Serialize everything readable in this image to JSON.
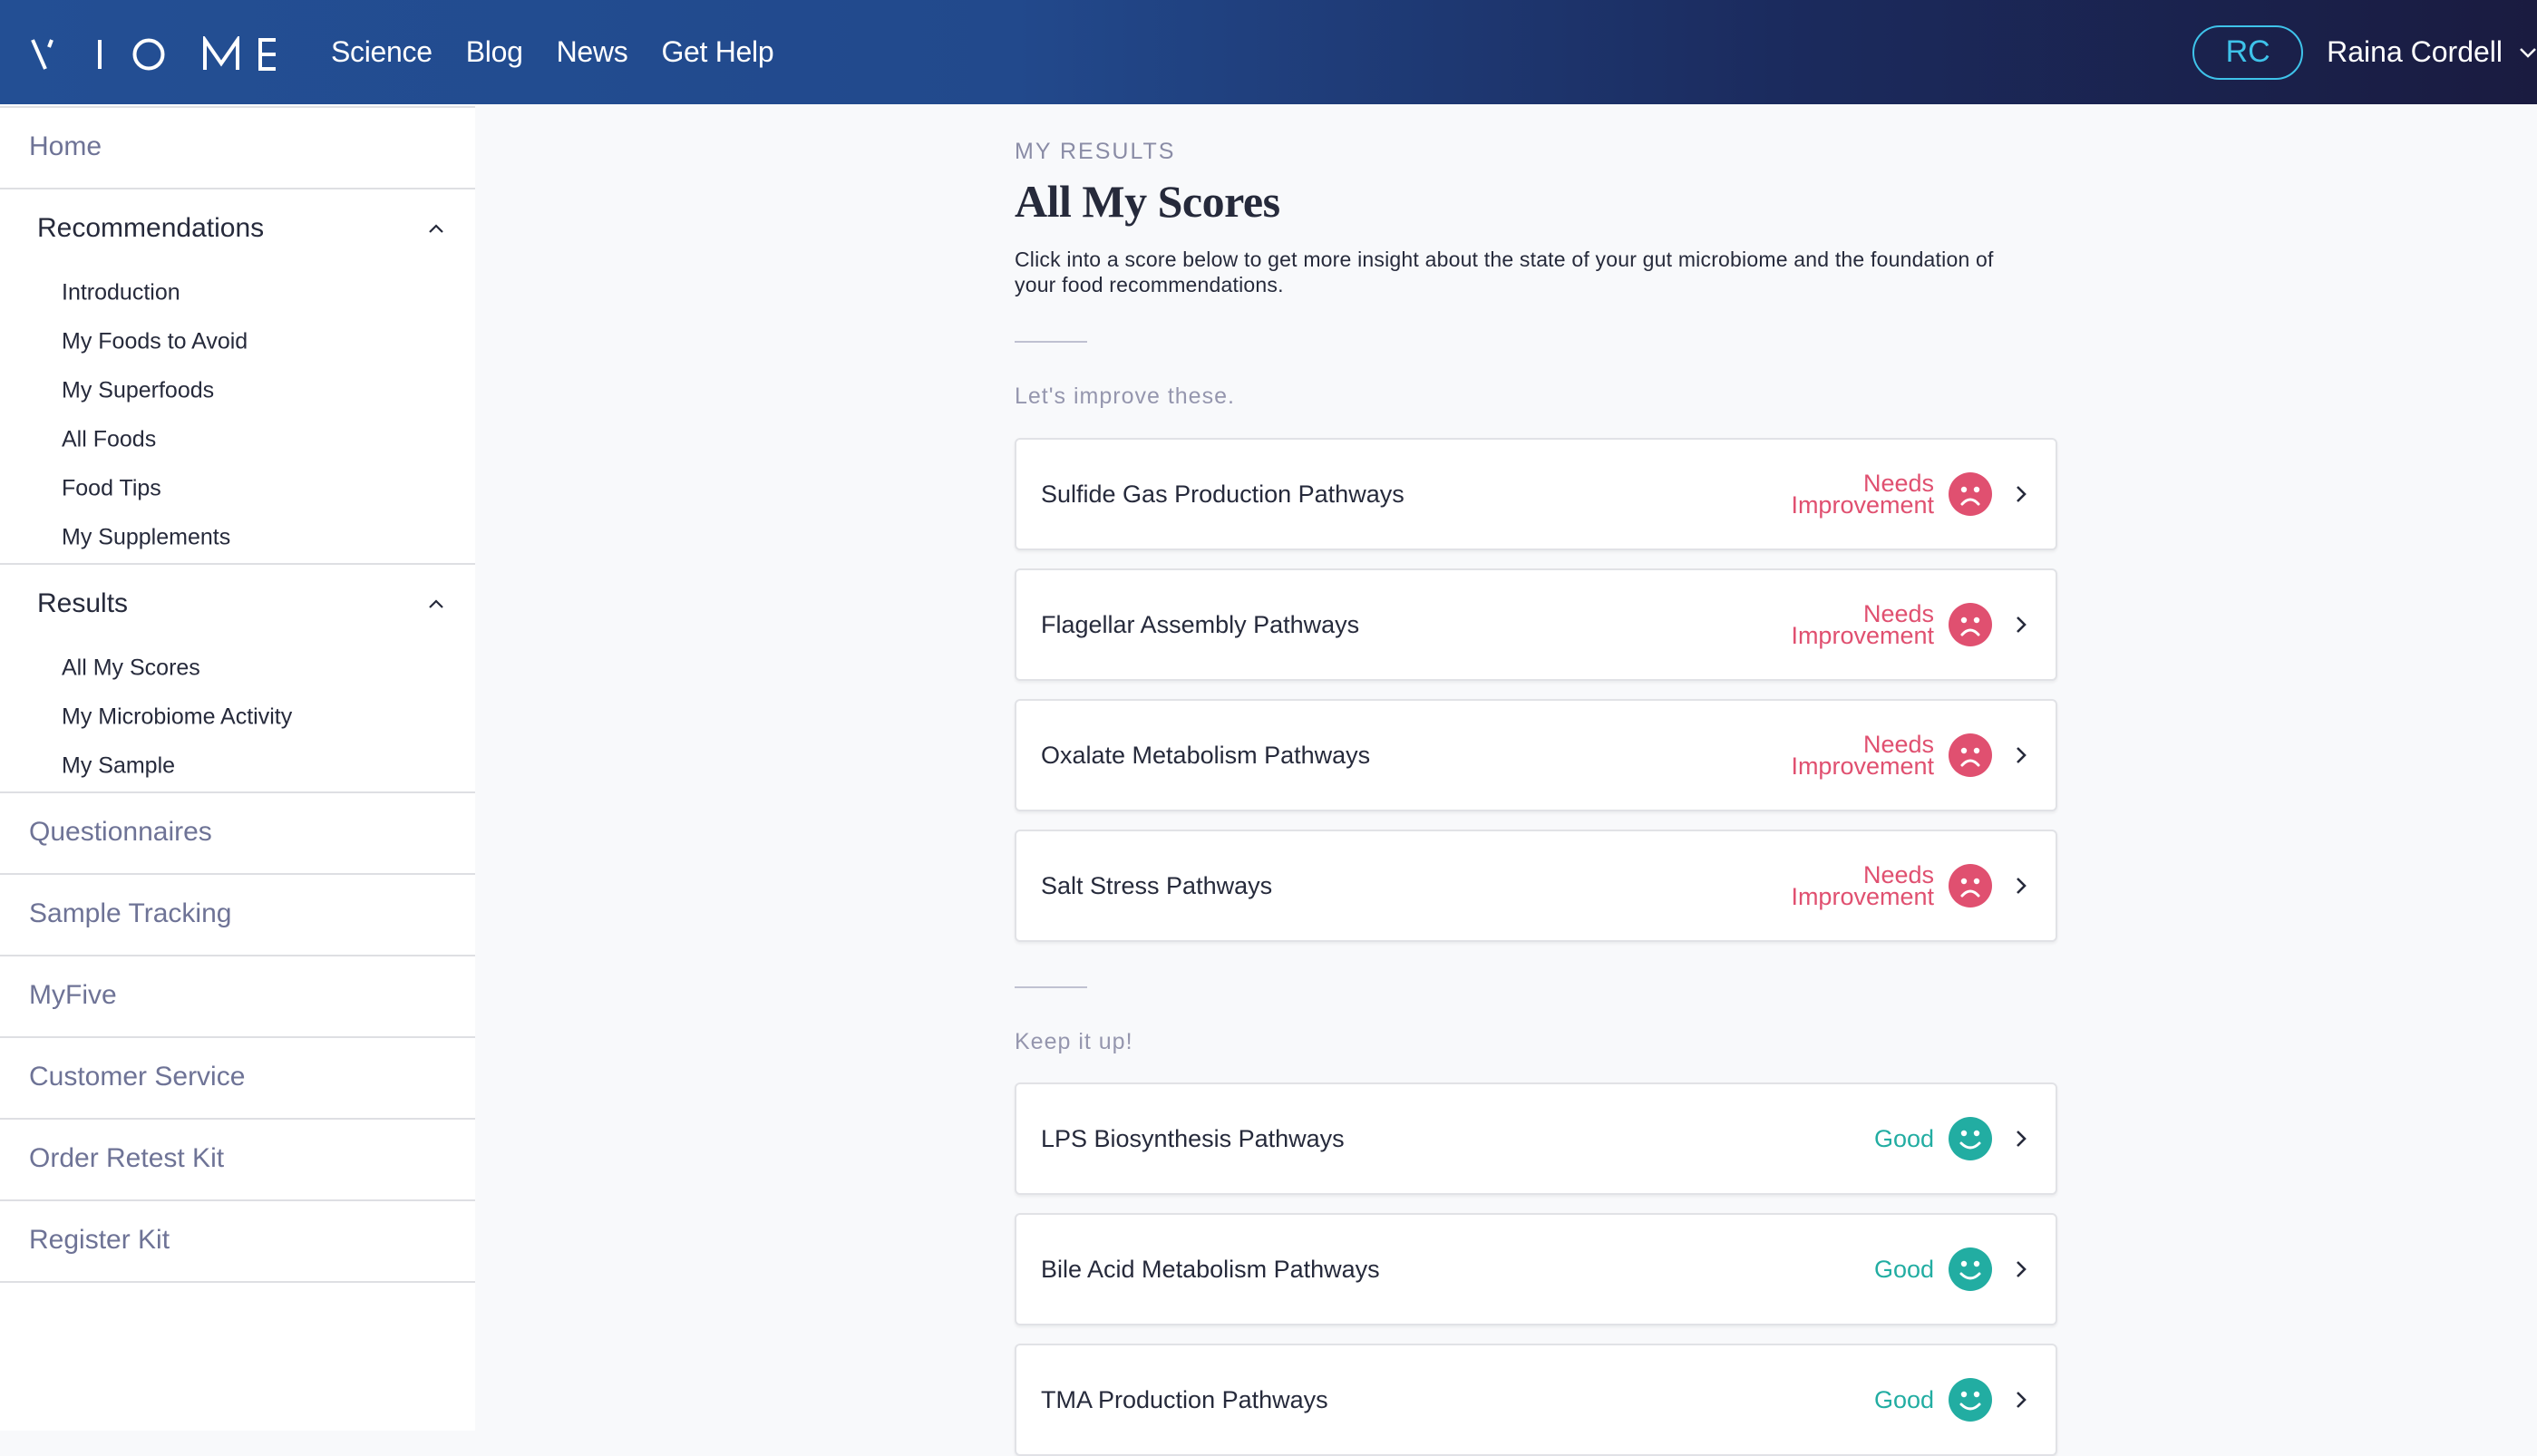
{
  "header": {
    "logo_text": "VIOME",
    "nav": [
      {
        "label": "Science"
      },
      {
        "label": "Blog"
      },
      {
        "label": "News"
      },
      {
        "label": "Get Help"
      }
    ],
    "user": {
      "initials": "RC",
      "name": "Raina Cordell",
      "menu_icon": "chevron-down-icon"
    },
    "colors": {
      "gradient_start": "#234f94",
      "gradient_end": "#1a1b40",
      "avatar_accent": "#3ec3ea"
    }
  },
  "sidebar": {
    "home": {
      "label": "Home"
    },
    "groups": [
      {
        "label": "Recommendations",
        "expanded": true,
        "icon": "chevron-up-icon",
        "items": [
          {
            "label": "Introduction"
          },
          {
            "label": "My Foods to Avoid"
          },
          {
            "label": "My Superfoods"
          },
          {
            "label": "All Foods"
          },
          {
            "label": "Food Tips"
          },
          {
            "label": "My Supplements"
          }
        ]
      },
      {
        "label": "Results",
        "expanded": true,
        "icon": "chevron-up-icon",
        "items": [
          {
            "label": "All My Scores",
            "active": true
          },
          {
            "label": "My Microbiome Activity"
          },
          {
            "label": "My Sample"
          }
        ]
      }
    ],
    "links": [
      {
        "label": "Questionnaires"
      },
      {
        "label": "Sample Tracking"
      },
      {
        "label": "MyFive"
      },
      {
        "label": "Customer Service"
      },
      {
        "label": "Order Retest Kit"
      },
      {
        "label": "Register Kit"
      }
    ]
  },
  "main": {
    "eyebrow": "MY RESULTS",
    "title": "All My Scores",
    "description": "Click into a score below to get more insight about the state of your gut microbiome and the foundation of your food recommendations.",
    "sections": [
      {
        "label": "Let's improve these.",
        "scores": [
          {
            "name": "Sulfide Gas Production Pathways",
            "status_line1": "Needs",
            "status_line2": "Improvement",
            "status": "needs-improvement",
            "icon": "sad-face-icon"
          },
          {
            "name": "Flagellar Assembly Pathways",
            "status_line1": "Needs",
            "status_line2": "Improvement",
            "status": "needs-improvement",
            "icon": "sad-face-icon"
          },
          {
            "name": "Oxalate Metabolism Pathways",
            "status_line1": "Needs",
            "status_line2": "Improvement",
            "status": "needs-improvement",
            "icon": "sad-face-icon"
          },
          {
            "name": "Salt Stress Pathways",
            "status_line1": "Needs",
            "status_line2": "Improvement",
            "status": "needs-improvement",
            "icon": "sad-face-icon"
          }
        ]
      },
      {
        "label": "Keep it up!",
        "scores": [
          {
            "name": "LPS Biosynthesis Pathways",
            "status_line1": "Good",
            "status": "good",
            "icon": "happy-face-icon"
          },
          {
            "name": "Bile Acid Metabolism Pathways",
            "status_line1": "Good",
            "status": "good",
            "icon": "happy-face-icon"
          },
          {
            "name": "TMA Production Pathways",
            "status_line1": "Good",
            "status": "good",
            "icon": "happy-face-icon"
          }
        ]
      }
    ],
    "colors": {
      "needs_improvement": "#e05070",
      "good": "#22ada2"
    }
  }
}
